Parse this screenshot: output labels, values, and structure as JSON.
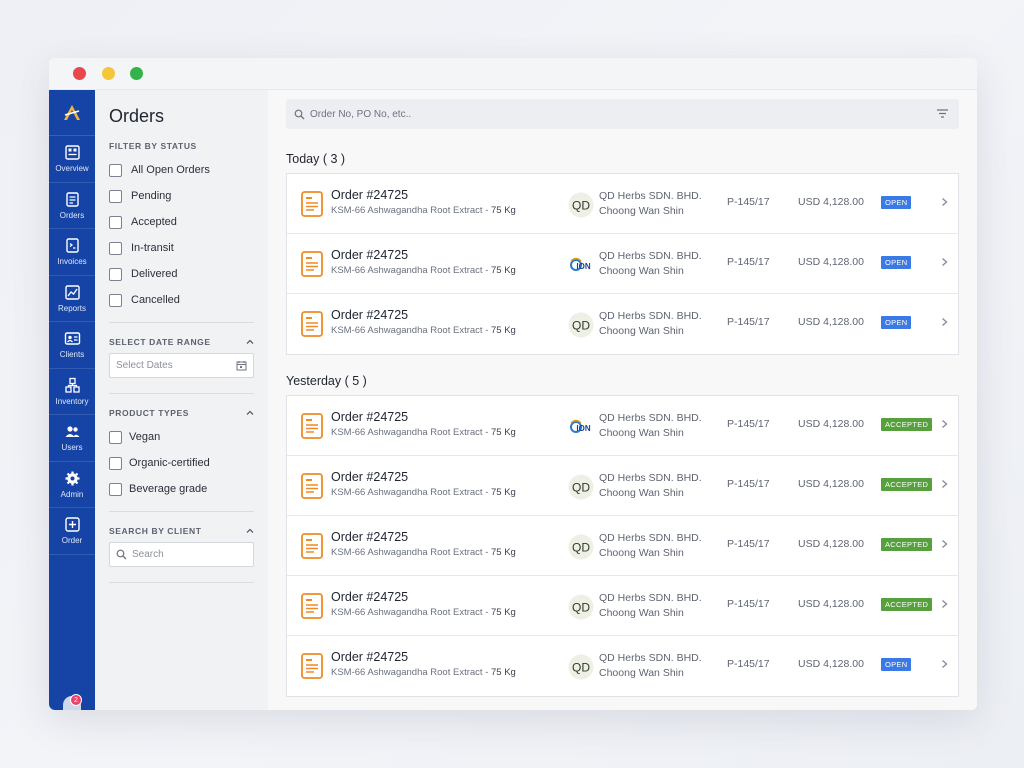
{
  "window": {
    "controls": [
      "close",
      "minimize",
      "maximize"
    ]
  },
  "rail": {
    "items": [
      {
        "label": "Overview",
        "icon": "overview-icon"
      },
      {
        "label": "Orders",
        "icon": "orders-icon"
      },
      {
        "label": "Invoices",
        "icon": "invoices-icon"
      },
      {
        "label": "Reports",
        "icon": "reports-icon"
      },
      {
        "label": "Clients",
        "icon": "clients-icon"
      },
      {
        "label": "Inventory",
        "icon": "inventory-icon"
      },
      {
        "label": "Users",
        "icon": "users-icon"
      },
      {
        "label": "Admin",
        "icon": "gear-icon"
      },
      {
        "label": "Order",
        "icon": "plus-icon"
      }
    ],
    "notification_count": "2"
  },
  "filters": {
    "title": "Orders",
    "status_title": "FILTER BY STATUS",
    "statuses": [
      "All Open Orders",
      "Pending",
      "Accepted",
      "In-transit",
      "Delivered",
      "Cancelled"
    ],
    "date_title": "SELECT DATE RANGE",
    "date_placeholder": "Select Dates",
    "product_title": "PRODUCT TYPES",
    "products": [
      "Vegan",
      "Organic-certified",
      "Beverage grade"
    ],
    "client_title": "SEARCH BY CLIENT",
    "client_placeholder": "Search"
  },
  "search": {
    "placeholder": "Order No, PO No, etc.."
  },
  "groups": [
    {
      "title": "Today ( 3 )",
      "orders": [
        {
          "order_no": "Order #24725",
          "desc": "KSM-66 Ashwagandha Root Extract - ",
          "qty": "75 Kg",
          "logo": "QD",
          "client": "QD Herbs SDN. BHD.",
          "contact": "Choong Wan Shin",
          "po": "P-145/17",
          "amount": "USD 4,128.00",
          "status": "OPEN"
        },
        {
          "order_no": "Order #24725",
          "desc": "KSM-66 Ashwagandha Root Extract - ",
          "qty": "75 Kg",
          "logo": "ION",
          "client": "QD Herbs SDN. BHD.",
          "contact": "Choong Wan Shin",
          "po": "P-145/17",
          "amount": "USD 4,128.00",
          "status": "OPEN"
        },
        {
          "order_no": "Order #24725",
          "desc": "KSM-66 Ashwagandha Root Extract - ",
          "qty": "75 Kg",
          "logo": "QD",
          "client": "QD Herbs SDN. BHD.",
          "contact": "Choong Wan Shin",
          "po": "P-145/17",
          "amount": "USD 4,128.00",
          "status": "OPEN"
        }
      ]
    },
    {
      "title": "Yesterday ( 5 )",
      "orders": [
        {
          "order_no": "Order #24725",
          "desc": "KSM-66 Ashwagandha Root Extract - ",
          "qty": "75 Kg",
          "logo": "ION",
          "client": "QD Herbs SDN. BHD.",
          "contact": "Choong Wan Shin",
          "po": "P-145/17",
          "amount": "USD 4,128.00",
          "status": "ACCEPTED"
        },
        {
          "order_no": "Order #24725",
          "desc": "KSM-66 Ashwagandha Root Extract - ",
          "qty": "75 Kg",
          "logo": "QD",
          "client": "QD Herbs SDN. BHD.",
          "contact": "Choong Wan Shin",
          "po": "P-145/17",
          "amount": "USD 4,128.00",
          "status": "ACCEPTED"
        },
        {
          "order_no": "Order #24725",
          "desc": "KSM-66 Ashwagandha Root Extract - ",
          "qty": "75 Kg",
          "logo": "QD",
          "client": "QD Herbs SDN. BHD.",
          "contact": "Choong Wan Shin",
          "po": "P-145/17",
          "amount": "USD 4,128.00",
          "status": "ACCEPTED"
        },
        {
          "order_no": "Order #24725",
          "desc": "KSM-66 Ashwagandha Root Extract - ",
          "qty": "75 Kg",
          "logo": "QD",
          "client": "QD Herbs SDN. BHD.",
          "contact": "Choong Wan Shin",
          "po": "P-145/17",
          "amount": "USD 4,128.00",
          "status": "ACCEPTED"
        },
        {
          "order_no": "Order #24725",
          "desc": "KSM-66 Ashwagandha Root Extract - ",
          "qty": "75 Kg",
          "logo": "QD",
          "client": "QD Herbs SDN. BHD.",
          "contact": "Choong Wan Shin",
          "po": "P-145/17",
          "amount": "USD 4,128.00",
          "status": "OPEN"
        }
      ]
    }
  ],
  "colors": {
    "rail": "#1644a6",
    "accent_orange": "#f08a24",
    "open": "#3a7ae6",
    "accepted": "#56a13d"
  }
}
